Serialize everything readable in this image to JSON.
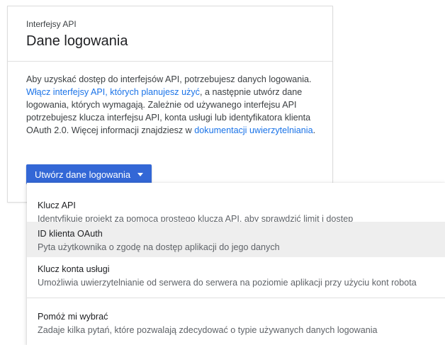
{
  "card": {
    "eyebrow": "Interfejsy API",
    "title": "Dane logowania",
    "description_part1": "Aby uzyskać dostęp do interfejsów API, potrzebujesz danych logowania. ",
    "link_enable_apis": "Włącz interfejsy API, których planujesz użyć",
    "description_part2": ", a następnie utwórz dane logowania, których wymagają. Zależnie od używanego interfejsu API potrzebujesz klucza interfejsu API, konta usługi lub identyfikatora klienta OAuth 2.0. Więcej informacji znajdziesz w ",
    "link_docs": "dokumentacji uwierzytelniania",
    "description_part3": ".",
    "create_button_label": "Utwórz dane logowania"
  },
  "menu": {
    "items": [
      {
        "title": "Klucz API",
        "description": "Identyfikuje projekt za pomocą prostego klucza API, aby sprawdzić limit i dostęp"
      },
      {
        "title": "ID klienta OAuth",
        "description": "Pyta użytkownika o zgodę na dostęp aplikacji do jego danych"
      },
      {
        "title": "Klucz konta usługi",
        "description": "Umożliwia uwierzytelnianie od serwera do serwera na poziomie aplikacji przy użyciu kont robota"
      },
      {
        "title": "Pomóż mi wybrać",
        "description": "Zadaje kilka pytań, które pozwalają zdecydować o typie używanych danych logowania"
      }
    ],
    "highlighted_index": 1
  },
  "colors": {
    "primary_button": "#3367d6",
    "link": "#1a73e8",
    "highlight_row": "#eeeeee"
  },
  "icons": {
    "dropdown": "caret-down-icon"
  }
}
